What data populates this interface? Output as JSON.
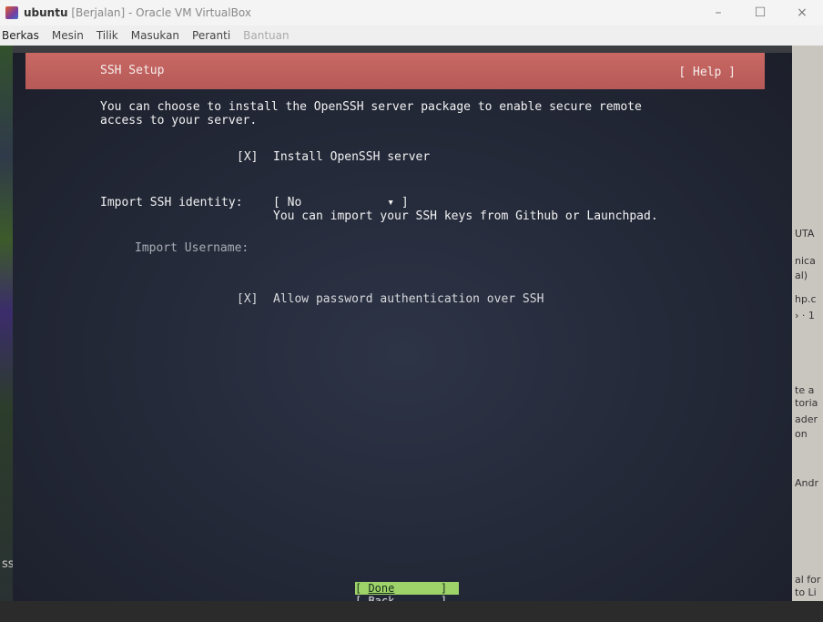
{
  "window": {
    "app_name": "ubuntu",
    "title_suffix": " [Berjalan] - Oracle VM VirtualBox",
    "controls": {
      "minimize": "–",
      "maximize": "☐",
      "close": "×"
    }
  },
  "menu": [
    "Berkas",
    "Mesin",
    "Tilik",
    "Masukan",
    "Peranti",
    "Bantuan"
  ],
  "installer": {
    "title": "SSH Setup",
    "help": "[ Help ]",
    "intro_line1": "You can choose to install the OpenSSH server package to enable secure remote",
    "intro_line2": "access to your server.",
    "install_checkbox": "[X]",
    "install_label": "Install OpenSSH server",
    "import_identity_label": "Import SSH identity:",
    "import_identity_value": "[ No            ▾ ]",
    "import_identity_hint": "You can import your SSH keys from Github or Launchpad.",
    "import_username_label": "Import Username:",
    "password_checkbox": "[X]",
    "password_label": "Allow password authentication over SSH",
    "done_open": "[ ",
    "done_label": "Done",
    "done_close": "       ]",
    "back_button": "[ Back       ]"
  },
  "background": {
    "right_snippets": [
      "UTA",
      "nica",
      "al)",
      "hp.c",
      "› · 1",
      "te a",
      "toria",
      "ader",
      "on",
      "Andr",
      "al for",
      "to Li"
    ],
    "left_snippet": "ss i"
  }
}
